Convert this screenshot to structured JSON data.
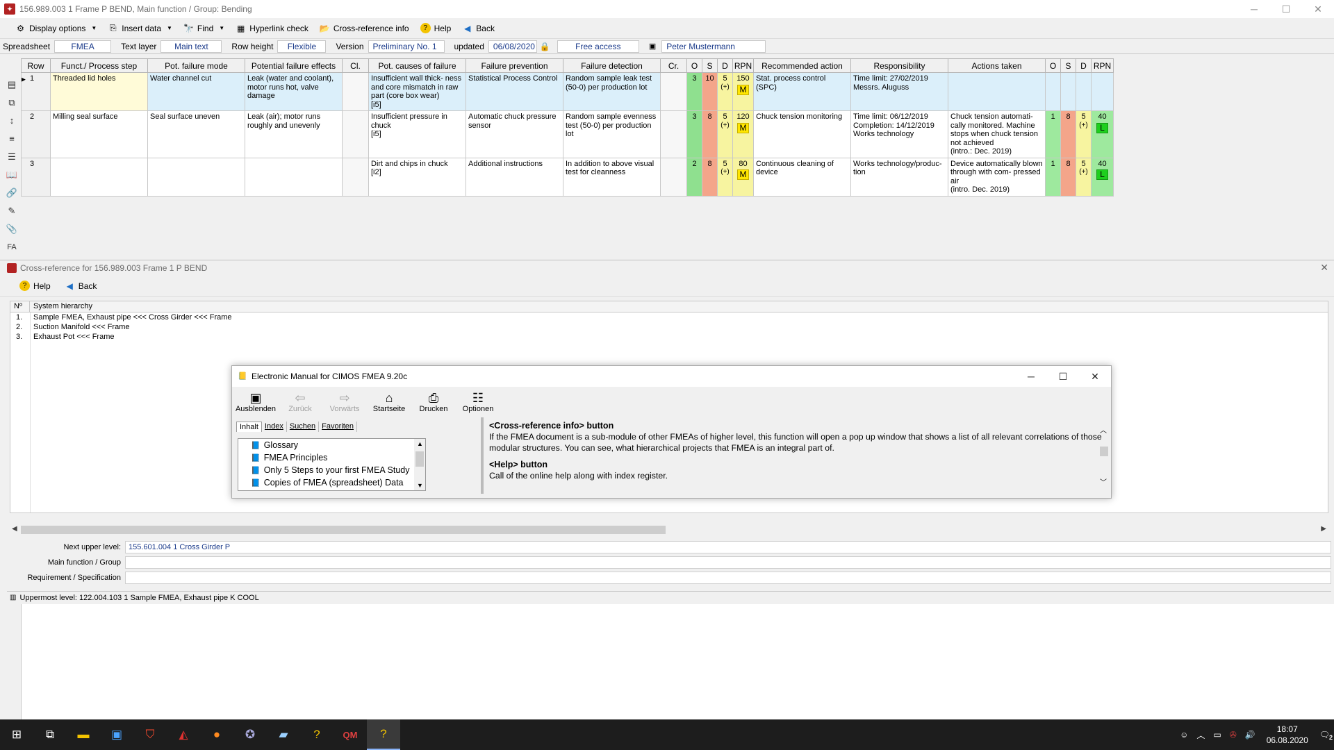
{
  "window": {
    "title": "156.989.003  1  Frame  P  BEND,  Main function / Group: Bending"
  },
  "toolbar": {
    "display_options": "Display options",
    "insert_data": "Insert data",
    "find": "Find",
    "hyperlink_check": "Hyperlink check",
    "cross_reference_info": "Cross-reference info",
    "help": "Help",
    "back": "Back"
  },
  "infobar": {
    "spreadsheet_label": "Spreadsheet",
    "spreadsheet_value": "FMEA",
    "text_layer_label": "Text layer",
    "text_layer_value": "Main text",
    "row_height_label": "Row height",
    "row_height_value": "Flexible",
    "version_label": "Version",
    "version_value": "Preliminary No. 1",
    "updated_label": "updated",
    "updated_value": "06/08/2020",
    "access_value": "Free access",
    "user_value": "Peter Mustermann"
  },
  "left_tools": {
    "fa_label": "FA"
  },
  "grid": {
    "headers": {
      "row": "Row",
      "funct": "Funct./ Process step",
      "mode": "Pot. failure mode",
      "effects": "Potential failure effects",
      "cl": "Cl.",
      "causes": "Pot. causes of failure",
      "prevention": "Failure prevention",
      "detection": "Failure detection",
      "cr": "Cr.",
      "o": "O",
      "s": "S",
      "d": "D",
      "rpn": "RPN",
      "action": "Recommended action",
      "resp": "Responsibility",
      "taken": "Actions taken",
      "o2": "O",
      "s2": "S",
      "d2": "D",
      "rpn2": "RPN"
    },
    "rows": [
      {
        "num": "1",
        "funct": "Threaded lid holes",
        "mode": "Water channel cut",
        "effects": "Leak (water and coolant), motor runs hot, valve damage",
        "causes": "Insufficient wall thick- ness and core mismatch in raw part (core box wear)\n[i5]",
        "prevention": "Statistical Process Control",
        "detection": "Random sample leak test (50-0) per production lot",
        "o": "3",
        "s": "10",
        "d": "5",
        "d_plus": "(+)",
        "rpn": "150",
        "rpn_badge": "M",
        "action": "Stat. process control (SPC)",
        "resp": "Time limit: 27/02/2019\nMessrs. Aluguss",
        "taken": "",
        "o2": "",
        "s2": "",
        "d2": "",
        "d2_plus": "",
        "rpn2": "",
        "rpn2_badge": ""
      },
      {
        "num": "2",
        "funct": "Milling seal surface",
        "mode": "Seal surface uneven",
        "effects": "Leak (air); motor runs roughly and unevenly",
        "causes": "Insufficient pressure in chuck\n[i5]",
        "prevention": "Automatic chuck pressure sensor",
        "detection": "Random sample evenness test (50-0) per production lot",
        "o": "3",
        "s": "8",
        "d": "5",
        "d_plus": "(+)",
        "rpn": "120",
        "rpn_badge": "M",
        "action": "Chuck tension monitoring",
        "resp": "Time limit: 06/12/2019\nCompletion: 14/12/2019\nWorks technology",
        "taken": "Chuck tension automati- cally monitored. Machine stops when chuck tension not achieved\n(intro.: Dec. 2019)",
        "o2": "1",
        "s2": "8",
        "d2": "5",
        "d2_plus": "(+)",
        "rpn2": "40",
        "rpn2_badge": "L"
      },
      {
        "num": "3",
        "funct": "",
        "mode": "",
        "effects": "",
        "causes": "Dirt and chips in chuck\n[i2]",
        "prevention": "Additional instructions",
        "detection": "In  addition  to  above visual test for cleanness",
        "o": "2",
        "s": "8",
        "d": "5",
        "d_plus": "(+)",
        "rpn": "80",
        "rpn_badge": "M",
        "action": "Continuous cleaning of device",
        "resp": "Works technology/produc- tion",
        "taken": "Device  automatically blown through with com- pressed air\n(intro. Dec. 2019)",
        "o2": "1",
        "s2": "8",
        "d2": "5",
        "d2_plus": "(+)",
        "rpn2": "40",
        "rpn2_badge": "L"
      }
    ]
  },
  "xref": {
    "title": "Cross-reference for 156.989.003 Frame 1 P BEND",
    "help": "Help",
    "back": "Back",
    "col_num": "Nº",
    "col_hier": "System hierarchy",
    "items": [
      {
        "n": "1.",
        "t": "Sample FMEA, Exhaust pipe <<< Cross Girder <<< Frame"
      },
      {
        "n": "2.",
        "t": "Suction Manifold <<< Frame"
      },
      {
        "n": "3.",
        "t": "Exhaust Pot <<< Frame"
      }
    ],
    "next_upper_label": "Next upper level:",
    "next_upper_value": "155.601.004  1  Cross Girder  P",
    "main_function_label": "Main function / Group",
    "main_function_value": "",
    "requirement_label": "Requirement / Specification",
    "requirement_value": "",
    "uppermost": "Uppermost level: 122.004.103  1  Sample FMEA, Exhaust pipe  K  COOL"
  },
  "manual": {
    "title": "Electronic Manual for CIMOS FMEA 9.20c",
    "tools": {
      "hide": "Ausblenden",
      "back": "Zurück",
      "forward": "Vorwärts",
      "home": "Startseite",
      "print": "Drucken",
      "options": "Optionen"
    },
    "tabs": {
      "contents": "Inhalt",
      "index": "Index",
      "search": "Suchen",
      "favorites": "Favoriten"
    },
    "tree": [
      "Glossary",
      "FMEA Principles",
      "Only 5 Steps to your first FMEA Study",
      "Copies of FMEA (spreadsheet) Data"
    ],
    "h1": "<Cross-reference info> button",
    "p1": "If the FMEA document is a sub-module of other FMEAs of higher level, this function will open a pop up window that shows a list of all relevant correlations of those modular structures. You can see, what hierarchical projects that FMEA is an integral part of.",
    "h2": "<Help> button",
    "p2": "Call of the online help along with index register."
  },
  "taskbar": {
    "time": "18:07",
    "date": "06.08.2020",
    "notifications": "2"
  }
}
